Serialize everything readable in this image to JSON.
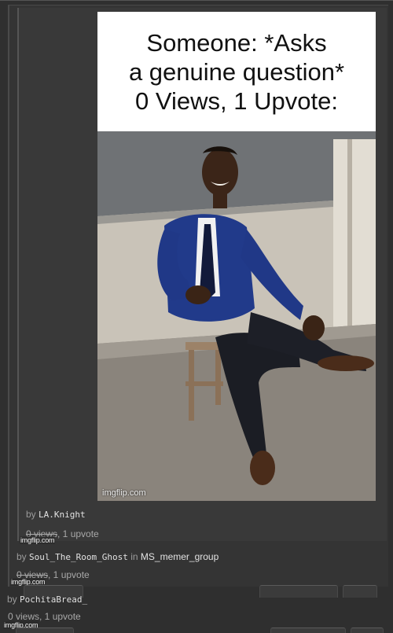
{
  "meme": {
    "caption_lines": [
      "Someone: *Asks",
      "a genuine question*",
      "0 Views, 1 Upvote:"
    ],
    "watermark": "imgflip.com"
  },
  "comments": [
    {
      "by": "by",
      "author": "LA.Knight",
      "stats": "0 views, 1 upvote",
      "stats_strike": "0 views",
      "stats_rest": ", 1 upvote",
      "watermark": "imgflip.com"
    },
    {
      "by": "by",
      "author": "Soul_The_Room_Ghost",
      "in": "in",
      "group": "MS_memer_group",
      "stats_strike": "0 views",
      "stats_rest": ", 1 upvote",
      "watermark": "imgflip.com"
    },
    {
      "by": "by",
      "author": "PochitaBread_",
      "stats": "0 views, 1 upvote",
      "watermark": "imgflip.com"
    }
  ]
}
